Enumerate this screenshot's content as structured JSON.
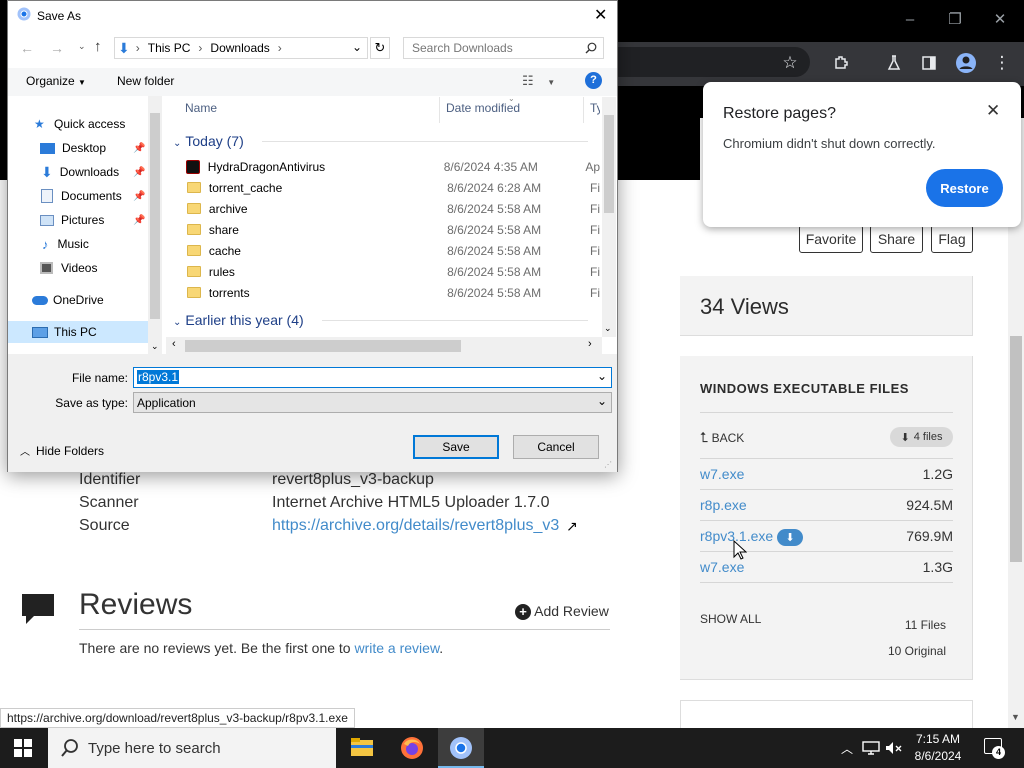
{
  "browser": {
    "window_controls": {
      "min": "–",
      "max": "❐",
      "close": "✕"
    }
  },
  "page": {
    "actions": [
      "Favorite",
      "Share",
      "Flag"
    ],
    "views": "34 Views",
    "files_panel": {
      "title": "WINDOWS EXECUTABLE FILES",
      "back": "BACK",
      "count_badge": "4 files",
      "files": [
        {
          "name": "w7.exe",
          "size": "1.2G"
        },
        {
          "name": "r8p.exe",
          "size": "924.5M"
        },
        {
          "name": "r8pv3.1.exe",
          "size": "769.9M"
        },
        {
          "name": "w7.exe",
          "size": "1.3G"
        }
      ],
      "show_all": "SHOW ALL",
      "total_files": "11 Files",
      "original_files": "10 Original"
    },
    "metadata": [
      {
        "key": "Identifier",
        "value": "revert8plus_v3-backup"
      },
      {
        "key": "Scanner",
        "value": "Internet Archive HTML5 Uploader 1.7.0"
      },
      {
        "key": "Source",
        "value": "https://archive.org/details/revert8plus_v3"
      }
    ],
    "reviews": {
      "title": "Reviews",
      "add": "Add Review",
      "empty_prefix": "There are no reviews yet. Be the first one to ",
      "empty_link": "write a review",
      "empty_suffix": "."
    },
    "status_url": "https://archive.org/download/revert8plus_v3-backup/r8pv3.1.exe"
  },
  "restore_popup": {
    "title": "Restore pages?",
    "message": "Chromium didn't shut down correctly.",
    "button": "Restore"
  },
  "dialog": {
    "title": "Save As",
    "breadcrumb": [
      "This PC",
      "Downloads"
    ],
    "search_placeholder": "Search Downloads",
    "organize": "Organize",
    "new_folder": "New folder",
    "nav": [
      {
        "label": "Quick access",
        "icon": "star-icon"
      },
      {
        "label": "Desktop",
        "icon": "desktop-icon",
        "pinned": true
      },
      {
        "label": "Downloads",
        "icon": "download-icon",
        "pinned": true
      },
      {
        "label": "Documents",
        "icon": "document-icon",
        "pinned": true
      },
      {
        "label": "Pictures",
        "icon": "picture-icon",
        "pinned": true
      },
      {
        "label": "Music",
        "icon": "music-icon"
      },
      {
        "label": "Videos",
        "icon": "video-icon"
      },
      {
        "label": "OneDrive",
        "icon": "cloud-icon"
      },
      {
        "label": "This PC",
        "icon": "computer-icon",
        "selected": true
      }
    ],
    "columns": {
      "name": "Name",
      "date": "Date modified",
      "type": "Ty"
    },
    "group_today": "Today (7)",
    "group_year": "Earlier this year (4)",
    "files": [
      {
        "name": "HydraDragonAntivirus",
        "date": "8/6/2024 4:35 AM",
        "type": "Ap",
        "kind": "app"
      },
      {
        "name": "torrent_cache",
        "date": "8/6/2024 6:28 AM",
        "type": "Fi",
        "kind": "folder"
      },
      {
        "name": "archive",
        "date": "8/6/2024 5:58 AM",
        "type": "Fi",
        "kind": "folder"
      },
      {
        "name": "share",
        "date": "8/6/2024 5:58 AM",
        "type": "Fi",
        "kind": "folder"
      },
      {
        "name": "cache",
        "date": "8/6/2024 5:58 AM",
        "type": "Fi",
        "kind": "folder"
      },
      {
        "name": "rules",
        "date": "8/6/2024 5:58 AM",
        "type": "Fi",
        "kind": "folder"
      },
      {
        "name": "torrents",
        "date": "8/6/2024 5:58 AM",
        "type": "Fi",
        "kind": "folder"
      }
    ],
    "file_name_label": "File name:",
    "file_name_value": "r8pv3.1",
    "save_type_label": "Save as type:",
    "save_type_value": "Application",
    "hide_folders": "Hide Folders",
    "save": "Save",
    "cancel": "Cancel"
  },
  "taskbar": {
    "search_placeholder": "Type here to search",
    "time": "7:15 AM",
    "date": "8/6/2024",
    "notifications": "4"
  }
}
